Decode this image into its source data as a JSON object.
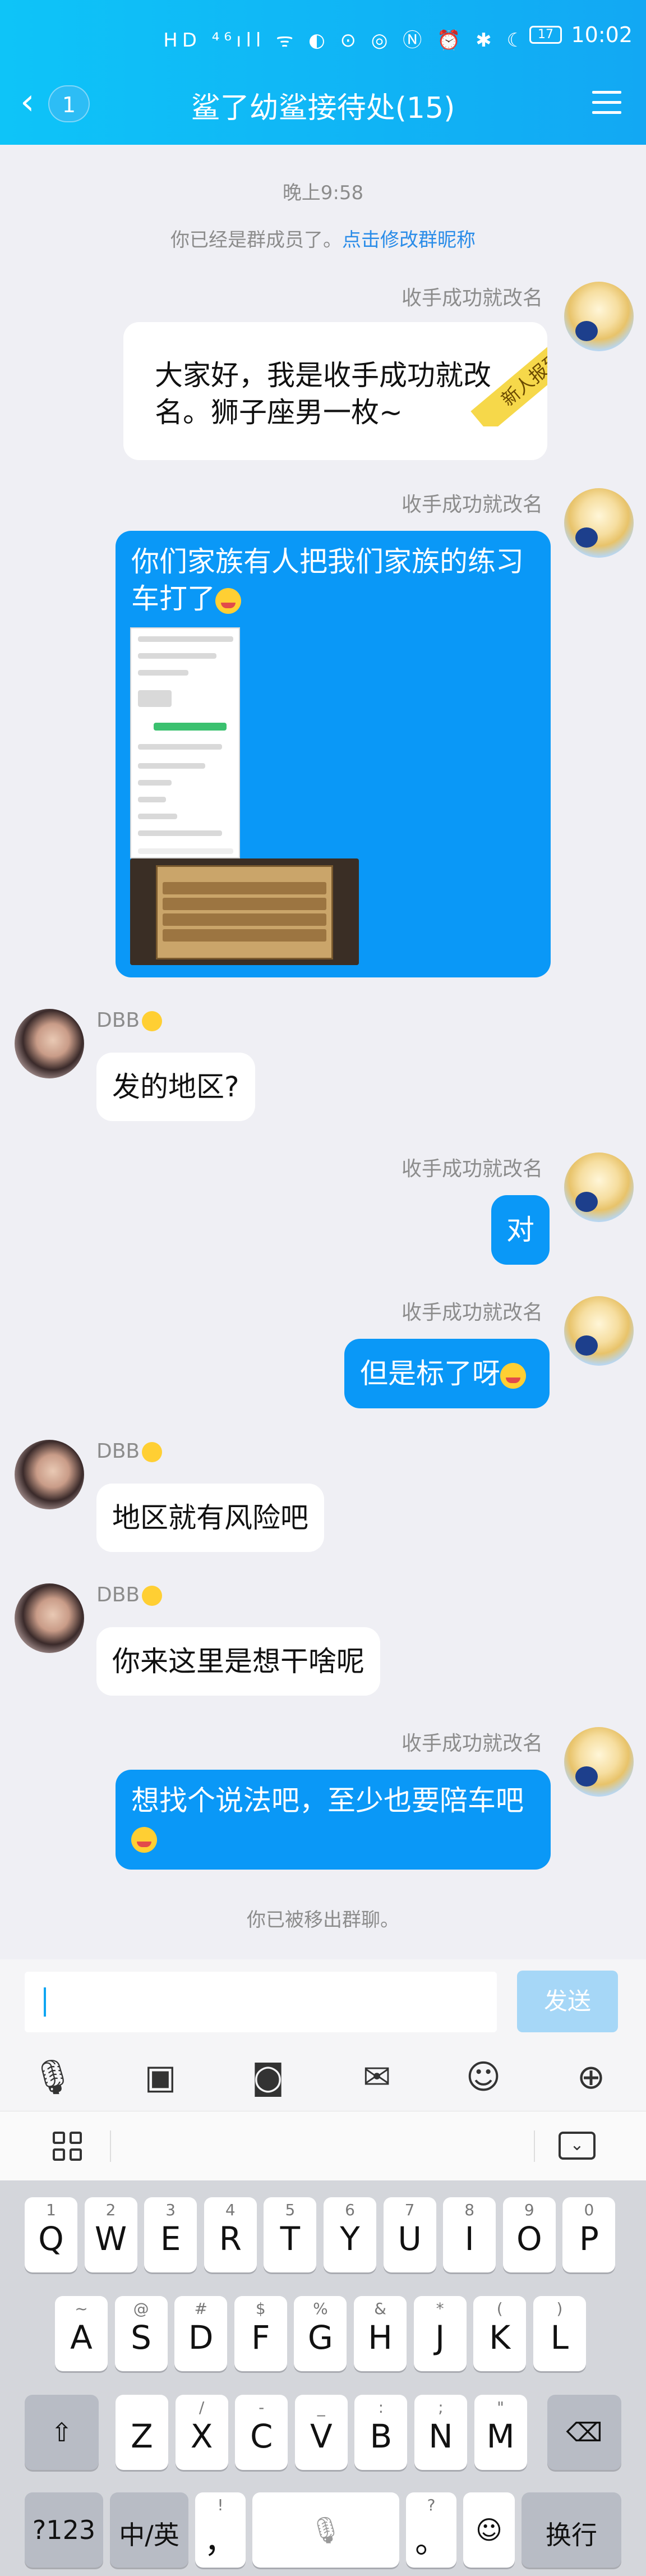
{
  "status": {
    "icons": "HD ⁴⁶ıll ᯤ ◐ ⊙ ◎ Ⓝ ⏰ ✱ ☾",
    "battery": "17",
    "time": "10:02"
  },
  "header": {
    "back_badge": "1",
    "title": "鲨了幼鲨接待处(15)"
  },
  "chat": {
    "timestamp": "晚上9:58",
    "joined_text": "你已经是群成员了。",
    "joined_link": "点击修改群昵称",
    "sender_self": "收手成功就改名",
    "sender_other": "DBB",
    "ribbon": "新人报到",
    "msg1": "大家好，我是收手成功就改名。狮子座男一枚~",
    "msg2": "你们家族有人把我们家族的练习车打了",
    "msg3": "发的地区?",
    "msg4": "对",
    "msg5": "但是标了呀",
    "msg6": "地区就有风险吧",
    "msg7": "你来这里是想干啥呢",
    "msg8": "想找个说法吧，至少也要陪车吧",
    "removed": "你已被移出群聊。"
  },
  "input": {
    "send_label": "发送"
  },
  "keyboard": {
    "row1": [
      [
        "1",
        "Q"
      ],
      [
        "2",
        "W"
      ],
      [
        "3",
        "E"
      ],
      [
        "4",
        "R"
      ],
      [
        "5",
        "T"
      ],
      [
        "6",
        "Y"
      ],
      [
        "7",
        "U"
      ],
      [
        "8",
        "I"
      ],
      [
        "9",
        "O"
      ],
      [
        "0",
        "P"
      ]
    ],
    "row2": [
      [
        "~",
        "A"
      ],
      [
        "@",
        "S"
      ],
      [
        "#",
        "D"
      ],
      [
        "$",
        "F"
      ],
      [
        "%",
        "G"
      ],
      [
        "&",
        "H"
      ],
      [
        "*",
        "J"
      ],
      [
        "(",
        "K"
      ],
      [
        ")",
        "L"
      ]
    ],
    "row3": [
      [
        "",
        "Z"
      ],
      [
        "/",
        "X"
      ],
      [
        "-",
        "C"
      ],
      [
        "_",
        "V"
      ],
      [
        ":",
        "B"
      ],
      [
        ";",
        "N"
      ],
      [
        "\"",
        "M"
      ]
    ],
    "num_label": "?123",
    "lang_label": "中/英",
    "comma_label": "，",
    "comma_sub": "!",
    "period_label": "。",
    "period_sub": "?",
    "enter_label": "换行",
    "shift_icon": "⇧",
    "backspace_icon": "⌫"
  },
  "colors": {
    "header": "#12a8f3",
    "bubble_blue": "#0a98f7",
    "link": "#2a8ce8",
    "send_disabled": "#a6d7f7"
  }
}
